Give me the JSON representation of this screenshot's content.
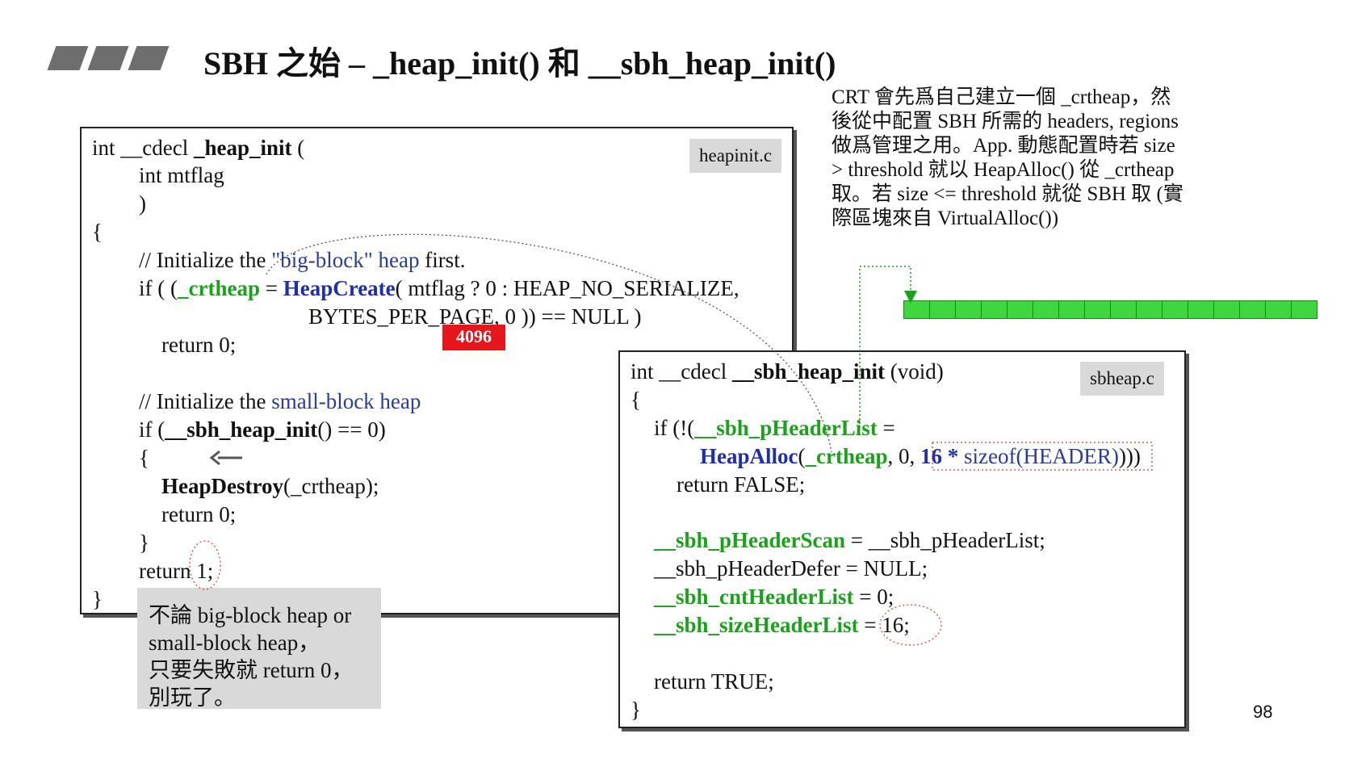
{
  "title": "SBH 之始 – _heap_init() 和 __sbh_heap_init()",
  "description": [
    "CRT 會先爲自己建立一個 _crtheap，然",
    "後從中配置 SBH 所需的 headers, regions",
    "做爲管理之用。App. 動態配置時若 size",
    "> threshold 就以 HeapAlloc() 從 _crtheap",
    "取。若 size <= threshold 就從 SBH 取 (實",
    "際區塊來自 VirtualAlloc())"
  ],
  "heapinit": {
    "filename": "heapinit.c",
    "lines": {
      "l1a": "int __cdecl ",
      "l1b": "_heap_init",
      "l1c": " (",
      "l2": "int mtflag",
      "l3": ")",
      "l4": "{",
      "l5a": "//  Initialize the ",
      "l5b": "\"big-block\" heap",
      "l5c": " first.",
      "l6a": "if ( (",
      "l6b": "_crtheap",
      "l6c": " = ",
      "l6d": "HeapCreate",
      "l6e": "( mtflag ? 0 : HEAP_NO_SERIALIZE,",
      "l7": "BYTES_PER_PAGE, 0 )) == NULL )",
      "l8": "return 0;",
      "l9a": "//  Initialize the ",
      "l9b": "small-block heap",
      "l10a": "if (",
      "l10b": "__sbh_heap_init",
      "l10c": "() == 0)",
      "l11": "{",
      "l12a": "HeapDestroy",
      "l12b": "(_crtheap);",
      "l13": "return 0;",
      "l14": "}",
      "l15": "return 1;",
      "l16": "}"
    },
    "badge": "4096"
  },
  "note": [
    "不論 big-block heap or",
    "small-block heap，",
    "只要失敗就 return 0，",
    "別玩了。"
  ],
  "sbheap": {
    "filename": "sbheap.c",
    "lines": {
      "l1a": "int __cdecl ",
      "l1b": "__sbh_heap_init",
      "l1c": " (void)",
      "l2": "{",
      "l3a": "if (!(",
      "l3b": "__sbh_pHeaderList",
      "l3c": " =",
      "l4a": "HeapAlloc",
      "l4b": "(",
      "l4c": "_crtheap",
      "l4d": ", 0, ",
      "l4e": "16 *",
      "l4f": " sizeof(HEADER)",
      "l4g": ")))",
      "l5": "return FALSE;",
      "l6a": "__sbh_pHeaderScan",
      "l6b": " = __sbh_pHeaderList;",
      "l7": "__sbh_pHeaderDefer = NULL;",
      "l8a": "__sbh_cntHeaderList",
      "l8b": " = 0;",
      "l9a": "__sbh_sizeHeaderList",
      "l9b": " = 16;",
      "l10": "return TRUE;",
      "l11": "}"
    }
  },
  "header_array_cells": 16,
  "page_number": "98",
  "colors": {
    "keyword_green": "#1aa31a",
    "identifier_blue": "#2a3b9c",
    "badge_red": "#e5161c",
    "note_gray": "#d9d9d9"
  }
}
